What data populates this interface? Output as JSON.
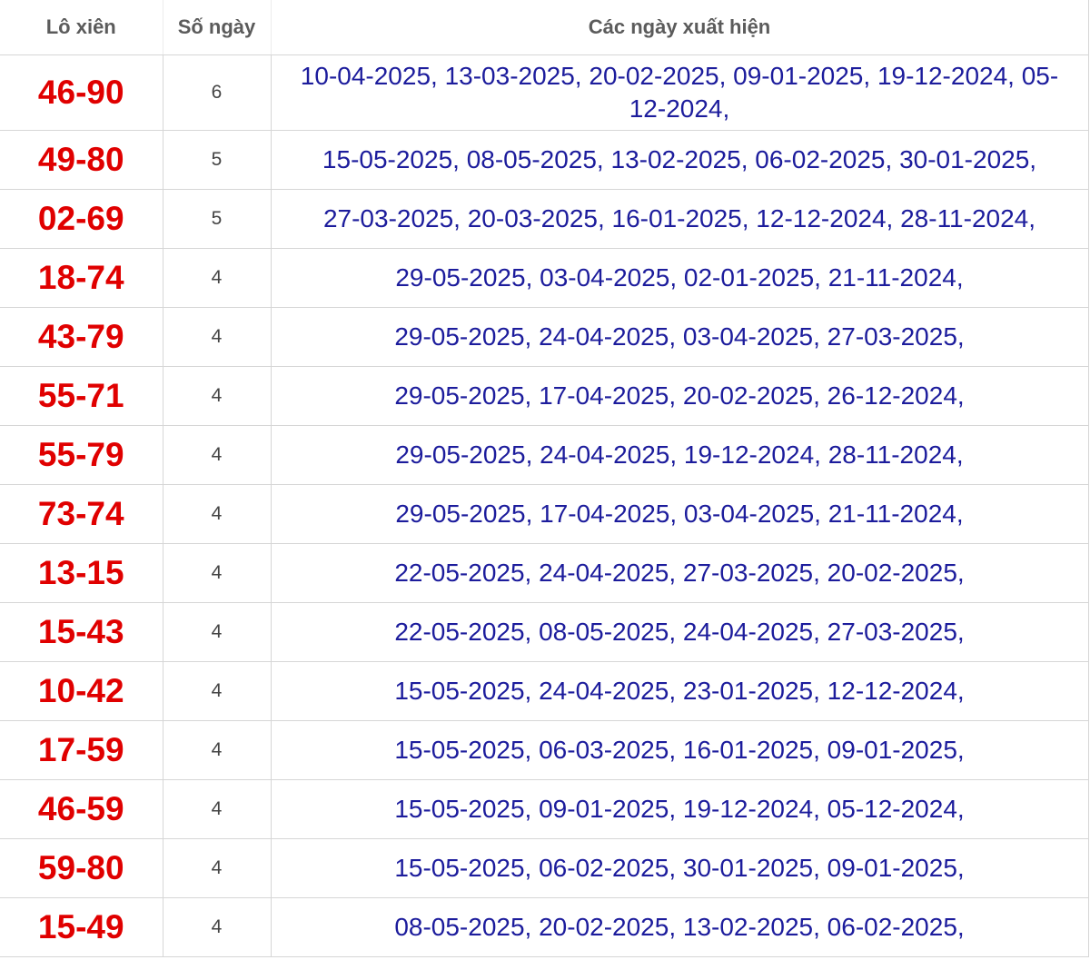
{
  "table": {
    "headers": [
      "Lô xiên",
      "Số ngày",
      "Các ngày xuất hiện"
    ],
    "rows": [
      {
        "pair": "46-90",
        "count": "6",
        "dates": "10-04-2025, 13-03-2025, 20-02-2025, 09-01-2025, 19-12-2024, 05-12-2024,"
      },
      {
        "pair": "49-80",
        "count": "5",
        "dates": "15-05-2025, 08-05-2025, 13-02-2025, 06-02-2025, 30-01-2025,"
      },
      {
        "pair": "02-69",
        "count": "5",
        "dates": "27-03-2025, 20-03-2025, 16-01-2025, 12-12-2024, 28-11-2024,"
      },
      {
        "pair": "18-74",
        "count": "4",
        "dates": "29-05-2025, 03-04-2025, 02-01-2025, 21-11-2024,"
      },
      {
        "pair": "43-79",
        "count": "4",
        "dates": "29-05-2025, 24-04-2025, 03-04-2025, 27-03-2025,"
      },
      {
        "pair": "55-71",
        "count": "4",
        "dates": "29-05-2025, 17-04-2025, 20-02-2025, 26-12-2024,"
      },
      {
        "pair": "55-79",
        "count": "4",
        "dates": "29-05-2025, 24-04-2025, 19-12-2024, 28-11-2024,"
      },
      {
        "pair": "73-74",
        "count": "4",
        "dates": "29-05-2025, 17-04-2025, 03-04-2025, 21-11-2024,"
      },
      {
        "pair": "13-15",
        "count": "4",
        "dates": "22-05-2025, 24-04-2025, 27-03-2025, 20-02-2025,"
      },
      {
        "pair": "15-43",
        "count": "4",
        "dates": "22-05-2025, 08-05-2025, 24-04-2025, 27-03-2025,"
      },
      {
        "pair": "10-42",
        "count": "4",
        "dates": "15-05-2025, 24-04-2025, 23-01-2025, 12-12-2024,"
      },
      {
        "pair": "17-59",
        "count": "4",
        "dates": "15-05-2025, 06-03-2025, 16-01-2025, 09-01-2025,"
      },
      {
        "pair": "46-59",
        "count": "4",
        "dates": "15-05-2025, 09-01-2025, 19-12-2024, 05-12-2024,"
      },
      {
        "pair": "59-80",
        "count": "4",
        "dates": "15-05-2025, 06-02-2025, 30-01-2025, 09-01-2025,"
      },
      {
        "pair": "15-49",
        "count": "4",
        "dates": "08-05-2025, 20-02-2025, 13-02-2025, 06-02-2025,"
      }
    ]
  },
  "colors": {
    "pair_text": "#e00000",
    "date_text": "#1c1c9c",
    "header_text": "#5b5b5b",
    "accent": "#d9363e"
  }
}
